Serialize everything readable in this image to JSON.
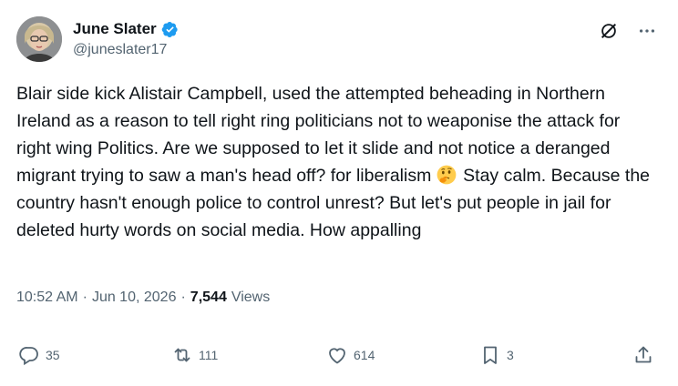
{
  "author": {
    "display_name": "June Slater",
    "handle": "@juneslater17",
    "verified": true
  },
  "header": {
    "grok_icon": "grok-slash-icon",
    "more_icon": "more-dots-icon"
  },
  "tweet": {
    "text_before_emoji": "Blair side kick Alistair Campbell, used the attempted beheading in Northern Ireland as a reason to tell right ring politicians not to weaponise the attack for right wing Politics. Are we supposed to let it slide and not notice a deranged migrant trying to saw a man's head off? for liberalism ",
    "emoji": "thinking-face",
    "text_after_emoji": " Stay calm. Because the country hasn't enough police to control unrest? But let's put people in jail for deleted hurty words on social media. How appalling"
  },
  "meta": {
    "time": "10:52 AM",
    "separator": "·",
    "date": "Jun 10, 2026",
    "views_count": "7,544",
    "views_label": "Views"
  },
  "actions": {
    "replies": "35",
    "reposts": "111",
    "likes": "614",
    "bookmarks": "3"
  },
  "colors": {
    "text": "#0f1419",
    "secondary": "#536471",
    "verified_blue": "#1d9bf0"
  }
}
